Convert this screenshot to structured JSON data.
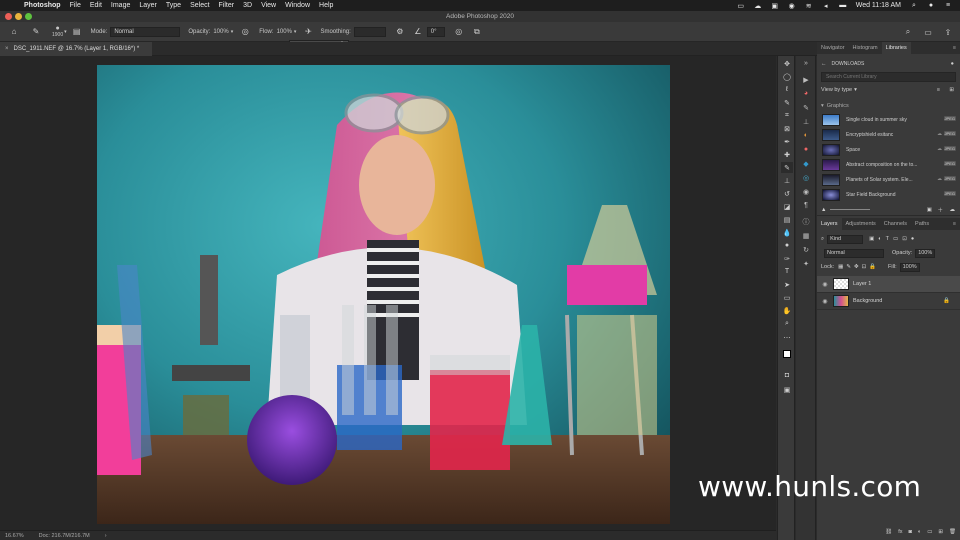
{
  "menubar": {
    "app": "Photoshop",
    "items": [
      "File",
      "Edit",
      "Image",
      "Layer",
      "Type",
      "Select",
      "Filter",
      "3D",
      "View",
      "Window",
      "Help"
    ],
    "clock": "Wed 11:18 AM"
  },
  "window": {
    "title": "Adobe Photoshop 2020"
  },
  "options": {
    "brush_size": "1900",
    "mode_label": "Mode:",
    "mode_value": "Normal",
    "opacity_label": "Opacity:",
    "opacity_value": "100%",
    "flow_label": "Flow:",
    "flow_value": "100%",
    "smoothing_label": "Smoothing:",
    "angle_value": "0°"
  },
  "document": {
    "tab_label": "DSC_1911.NEF @ 16.7% (Layer 1, RGB/16*) *"
  },
  "statusbar": {
    "zoom": "16.67%",
    "doc": "Doc: 216.7M/216.7M"
  },
  "panel": {
    "top_tabs": [
      "Navigator",
      "Histogram",
      "Libraries"
    ],
    "library_name": "DOWNLOADS",
    "search_placeholder": "Search Current Library",
    "view_by": "View by type",
    "group": "Graphics",
    "items": [
      {
        "name": "Single cloud in summer sky",
        "badge": "JPEG"
      },
      {
        "name": "Encryptshield esitanc",
        "badge": "JPEG"
      },
      {
        "name": "Space",
        "badge": "JPEG"
      },
      {
        "name": "Abstract composition on the to...",
        "badge": "JPEG"
      },
      {
        "name": "Planets of Solar system. Ele...",
        "badge": "JPEG"
      },
      {
        "name": "Star Field Background",
        "badge": "JPEG"
      }
    ],
    "layer_tabs": [
      "Layers",
      "Adjustments",
      "Channels",
      "Paths"
    ],
    "kind": "Kind",
    "blend_mode": "Normal",
    "opacity_label": "Opacity:",
    "opacity_value": "100%",
    "lock_label": "Lock:",
    "fill_label": "Fill:",
    "fill_value": "100%",
    "layers": [
      {
        "name": "Layer 1"
      },
      {
        "name": "Background"
      }
    ]
  },
  "watermark": "www.hunls.com",
  "colors": {
    "accent": "#2e6fd8",
    "panel": "#3a3a3a",
    "canvas": "#262626"
  }
}
